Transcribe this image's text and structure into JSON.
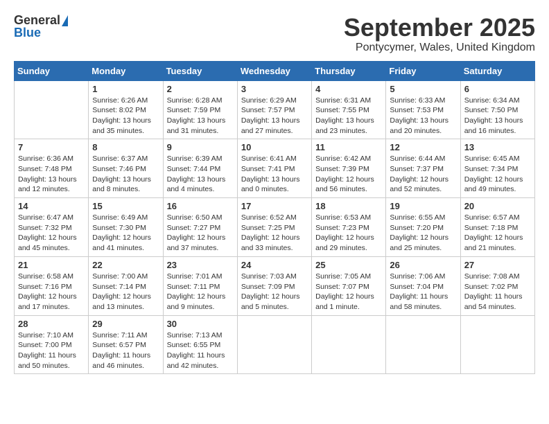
{
  "logo": {
    "general": "General",
    "blue": "Blue"
  },
  "header": {
    "month": "September 2025",
    "location": "Pontycymer, Wales, United Kingdom"
  },
  "weekdays": [
    "Sunday",
    "Monday",
    "Tuesday",
    "Wednesday",
    "Thursday",
    "Friday",
    "Saturday"
  ],
  "weeks": [
    [
      {
        "day": "",
        "info": ""
      },
      {
        "day": "1",
        "info": "Sunrise: 6:26 AM\nSunset: 8:02 PM\nDaylight: 13 hours\nand 35 minutes."
      },
      {
        "day": "2",
        "info": "Sunrise: 6:28 AM\nSunset: 7:59 PM\nDaylight: 13 hours\nand 31 minutes."
      },
      {
        "day": "3",
        "info": "Sunrise: 6:29 AM\nSunset: 7:57 PM\nDaylight: 13 hours\nand 27 minutes."
      },
      {
        "day": "4",
        "info": "Sunrise: 6:31 AM\nSunset: 7:55 PM\nDaylight: 13 hours\nand 23 minutes."
      },
      {
        "day": "5",
        "info": "Sunrise: 6:33 AM\nSunset: 7:53 PM\nDaylight: 13 hours\nand 20 minutes."
      },
      {
        "day": "6",
        "info": "Sunrise: 6:34 AM\nSunset: 7:50 PM\nDaylight: 13 hours\nand 16 minutes."
      }
    ],
    [
      {
        "day": "7",
        "info": "Sunrise: 6:36 AM\nSunset: 7:48 PM\nDaylight: 13 hours\nand 12 minutes."
      },
      {
        "day": "8",
        "info": "Sunrise: 6:37 AM\nSunset: 7:46 PM\nDaylight: 13 hours\nand 8 minutes."
      },
      {
        "day": "9",
        "info": "Sunrise: 6:39 AM\nSunset: 7:44 PM\nDaylight: 13 hours\nand 4 minutes."
      },
      {
        "day": "10",
        "info": "Sunrise: 6:41 AM\nSunset: 7:41 PM\nDaylight: 13 hours\nand 0 minutes."
      },
      {
        "day": "11",
        "info": "Sunrise: 6:42 AM\nSunset: 7:39 PM\nDaylight: 12 hours\nand 56 minutes."
      },
      {
        "day": "12",
        "info": "Sunrise: 6:44 AM\nSunset: 7:37 PM\nDaylight: 12 hours\nand 52 minutes."
      },
      {
        "day": "13",
        "info": "Sunrise: 6:45 AM\nSunset: 7:34 PM\nDaylight: 12 hours\nand 49 minutes."
      }
    ],
    [
      {
        "day": "14",
        "info": "Sunrise: 6:47 AM\nSunset: 7:32 PM\nDaylight: 12 hours\nand 45 minutes."
      },
      {
        "day": "15",
        "info": "Sunrise: 6:49 AM\nSunset: 7:30 PM\nDaylight: 12 hours\nand 41 minutes."
      },
      {
        "day": "16",
        "info": "Sunrise: 6:50 AM\nSunset: 7:27 PM\nDaylight: 12 hours\nand 37 minutes."
      },
      {
        "day": "17",
        "info": "Sunrise: 6:52 AM\nSunset: 7:25 PM\nDaylight: 12 hours\nand 33 minutes."
      },
      {
        "day": "18",
        "info": "Sunrise: 6:53 AM\nSunset: 7:23 PM\nDaylight: 12 hours\nand 29 minutes."
      },
      {
        "day": "19",
        "info": "Sunrise: 6:55 AM\nSunset: 7:20 PM\nDaylight: 12 hours\nand 25 minutes."
      },
      {
        "day": "20",
        "info": "Sunrise: 6:57 AM\nSunset: 7:18 PM\nDaylight: 12 hours\nand 21 minutes."
      }
    ],
    [
      {
        "day": "21",
        "info": "Sunrise: 6:58 AM\nSunset: 7:16 PM\nDaylight: 12 hours\nand 17 minutes."
      },
      {
        "day": "22",
        "info": "Sunrise: 7:00 AM\nSunset: 7:14 PM\nDaylight: 12 hours\nand 13 minutes."
      },
      {
        "day": "23",
        "info": "Sunrise: 7:01 AM\nSunset: 7:11 PM\nDaylight: 12 hours\nand 9 minutes."
      },
      {
        "day": "24",
        "info": "Sunrise: 7:03 AM\nSunset: 7:09 PM\nDaylight: 12 hours\nand 5 minutes."
      },
      {
        "day": "25",
        "info": "Sunrise: 7:05 AM\nSunset: 7:07 PM\nDaylight: 12 hours\nand 1 minute."
      },
      {
        "day": "26",
        "info": "Sunrise: 7:06 AM\nSunset: 7:04 PM\nDaylight: 11 hours\nand 58 minutes."
      },
      {
        "day": "27",
        "info": "Sunrise: 7:08 AM\nSunset: 7:02 PM\nDaylight: 11 hours\nand 54 minutes."
      }
    ],
    [
      {
        "day": "28",
        "info": "Sunrise: 7:10 AM\nSunset: 7:00 PM\nDaylight: 11 hours\nand 50 minutes."
      },
      {
        "day": "29",
        "info": "Sunrise: 7:11 AM\nSunset: 6:57 PM\nDaylight: 11 hours\nand 46 minutes."
      },
      {
        "day": "30",
        "info": "Sunrise: 7:13 AM\nSunset: 6:55 PM\nDaylight: 11 hours\nand 42 minutes."
      },
      {
        "day": "",
        "info": ""
      },
      {
        "day": "",
        "info": ""
      },
      {
        "day": "",
        "info": ""
      },
      {
        "day": "",
        "info": ""
      }
    ]
  ]
}
